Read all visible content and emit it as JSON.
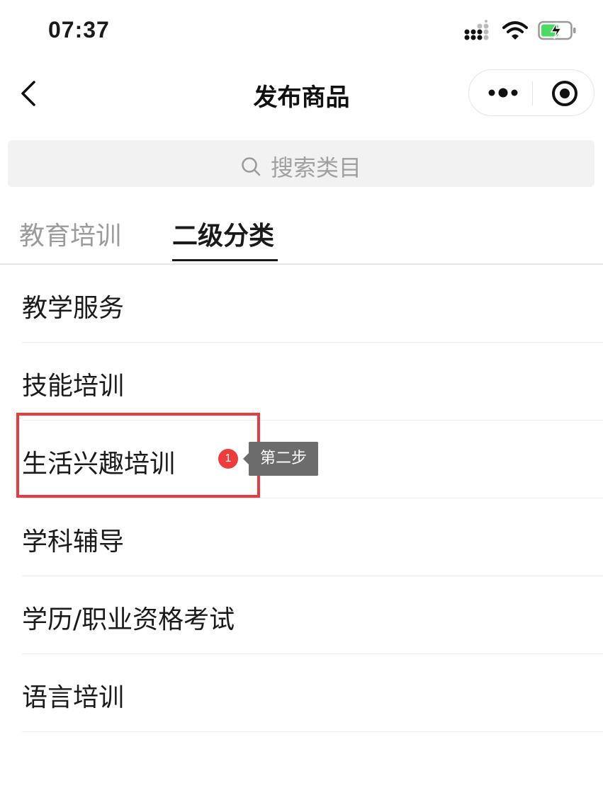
{
  "status_bar": {
    "time": "07:37",
    "signal_icon": "signal-icon",
    "wifi_icon": "wifi-icon",
    "battery_icon": "battery-charging-icon",
    "battery_color": "#4cd964"
  },
  "nav": {
    "title": "发布商品",
    "back_icon": "back-chevron-icon",
    "more_icon": "more-dots-icon",
    "close_icon": "record-target-icon"
  },
  "search": {
    "placeholder": "搜索类目",
    "icon": "search-icon"
  },
  "tabs": [
    {
      "label": "教育培训",
      "active": false
    },
    {
      "label": "二级分类",
      "active": true
    }
  ],
  "categories": [
    {
      "label": "教学服务"
    },
    {
      "label": "技能培训"
    },
    {
      "label": "生活兴趣培训"
    },
    {
      "label": "学科辅导"
    },
    {
      "label": "学历/职业资格考试"
    },
    {
      "label": "语言培训"
    }
  ],
  "annotation": {
    "badge_number": "1",
    "tooltip_text": "第二步",
    "highlight_color": "#e63b3f",
    "badge_color": "#ee3b3b"
  }
}
